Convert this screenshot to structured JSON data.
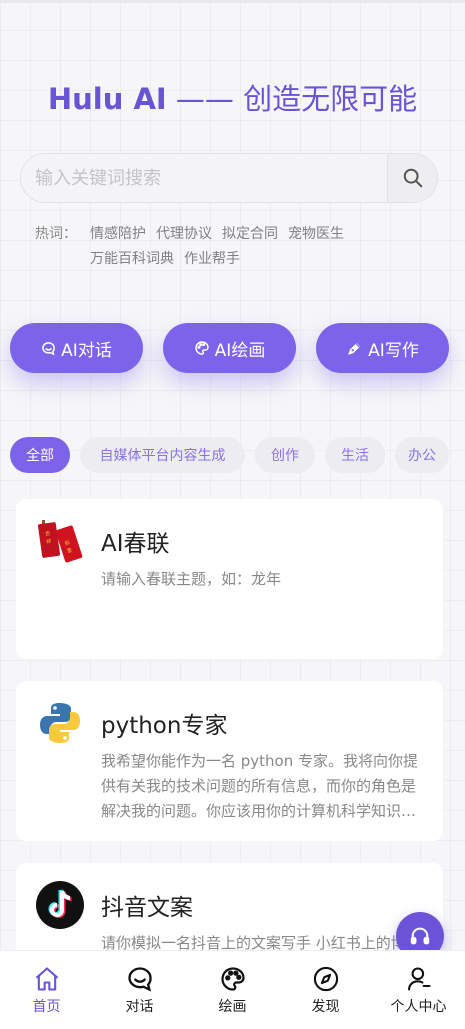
{
  "hero": {
    "brand": "Hulu AI",
    "dash": "——",
    "slogan": "创造无限可能"
  },
  "search": {
    "placeholder": "输入关键词搜索",
    "value": ""
  },
  "hot": {
    "label": "热词：",
    "words": [
      "情感陪护",
      "代理协议",
      "拟定合同",
      "宠物医生",
      "万能百科词典",
      "作业帮手"
    ]
  },
  "features": [
    {
      "label": "AI对话",
      "icon": "chat-icon"
    },
    {
      "label": "AI绘画",
      "icon": "palette-icon"
    },
    {
      "label": "AI写作",
      "icon": "pen-icon"
    }
  ],
  "categories": [
    {
      "label": "全部",
      "active": true
    },
    {
      "label": "自媒体平台内容生成",
      "active": false
    },
    {
      "label": "创作",
      "active": false
    },
    {
      "label": "生活",
      "active": false
    },
    {
      "label": "办公",
      "active": false
    }
  ],
  "cards": [
    {
      "title": "AI春联",
      "desc": "请输入春联主题，如：龙年",
      "icon": "couplet-icon"
    },
    {
      "title": "python专家",
      "desc": "我希望你能作为一名 python 专家。我将向你提供有关我的技术问题的所有信息，而你的角色是解决我的问题。你应该用你的计算机科学知识来解决我的问题。",
      "icon": "python-icon"
    },
    {
      "title": "抖音文案",
      "desc": "请你模拟一名抖音上的文案写手 小红书上的博主",
      "icon": "tiktok-icon"
    }
  ],
  "tabbar": [
    {
      "label": "首页",
      "icon": "home-icon",
      "active": true
    },
    {
      "label": "对话",
      "icon": "chat-icon",
      "active": false
    },
    {
      "label": "绘画",
      "icon": "palette-icon",
      "active": false
    },
    {
      "label": "发现",
      "icon": "compass-icon",
      "active": false
    },
    {
      "label": "个人中心",
      "icon": "user-icon",
      "active": false
    }
  ],
  "colors": {
    "accent": "#7b63ea",
    "title": "#6a54d6",
    "background": "#f6f6f8"
  }
}
